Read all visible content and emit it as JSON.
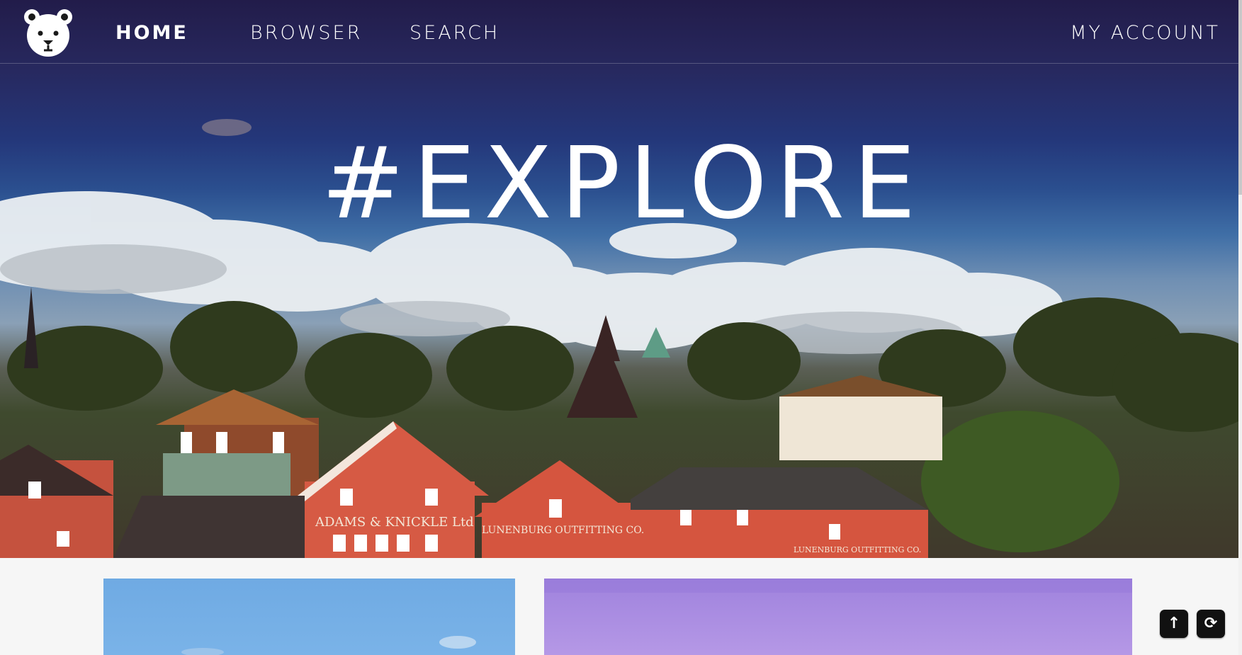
{
  "nav": {
    "logo_icon": "bear-head-icon",
    "items": [
      {
        "label": "HOME",
        "active": true
      },
      {
        "label": "BROWSER",
        "active": false
      },
      {
        "label": "SEARCH",
        "active": false
      }
    ],
    "account_label": "MY ACCOUNT"
  },
  "hero": {
    "title": "#EXPLORE",
    "sign_1": "ADAMS & KNICKLE Ltd",
    "sign_2": "LUNENBURG OUTFITTING CO.",
    "sign_3": "LUNENBURG OUTFITTING CO."
  },
  "cards": [
    {
      "image": "blue-sky-photo"
    },
    {
      "image": "purple-sky-photo"
    }
  ],
  "floating_buttons": {
    "scroll_top_icon": "arrow-up-icon",
    "scroll_top_glyph": "↑",
    "refresh_icon": "refresh-icon",
    "refresh_glyph": "⟳"
  },
  "colors": {
    "nav_bg": "#221c4a",
    "text": "#ffffff",
    "page_bg": "#f6f6f6",
    "fab_bg": "#111111"
  }
}
